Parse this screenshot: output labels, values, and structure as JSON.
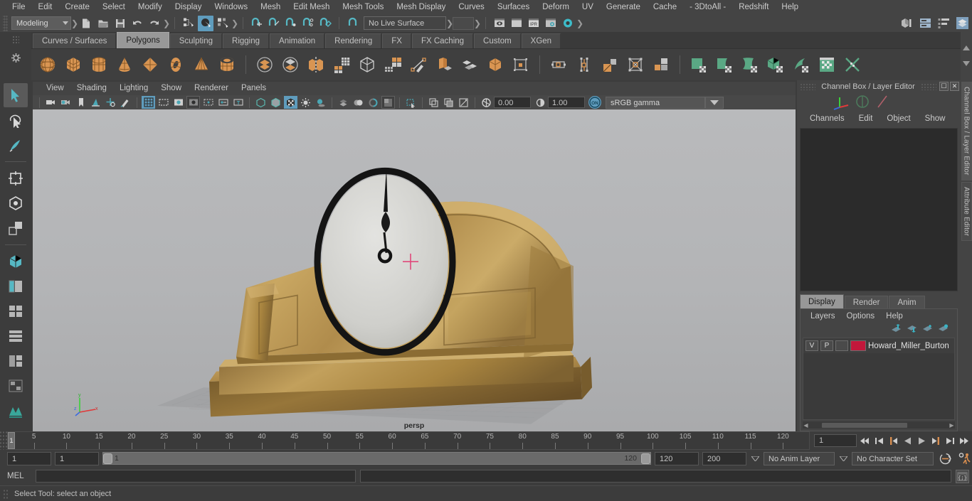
{
  "app": {
    "menus": [
      "File",
      "Edit",
      "Create",
      "Select",
      "Modify",
      "Display",
      "Windows",
      "Mesh",
      "Edit Mesh",
      "Mesh Tools",
      "Mesh Display",
      "Curves",
      "Surfaces",
      "Deform",
      "UV",
      "Generate",
      "Cache",
      "- 3DtoAll -",
      "Redshift",
      "Help"
    ]
  },
  "status_line": {
    "menu_set": "Modeling",
    "live_surface": "No Live Surface",
    "icons": [
      "new-scene-icon",
      "open-scene-icon",
      "save-scene-icon",
      "undo-icon",
      "redo-icon",
      "select-hierarchy-icon",
      "select-object-icon",
      "select-component-icon",
      "snap-to-grid-icon",
      "snap-to-curve-icon",
      "snap-to-point-icon",
      "snap-to-projected-center-icon",
      "snap-to-view-plane-icon",
      "make-live-icon",
      "render-view-icon",
      "render-current-frame-icon",
      "ipr-render-icon",
      "render-settings-icon",
      "hypershade-icon"
    ],
    "right_icons": [
      "show-hide-modeling-toolkit-icon",
      "show-hide-attribute-editor-icon",
      "show-hide-tool-settings-icon",
      "show-hide-channel-box-icon"
    ]
  },
  "shelf": {
    "tabs": [
      "Curves / Surfaces",
      "Polygons",
      "Sculpting",
      "Rigging",
      "Animation",
      "Rendering",
      "FX",
      "FX Caching",
      "Custom",
      "XGen"
    ],
    "selected_tab": "Polygons",
    "icons": [
      "poly-sphere-icon",
      "poly-cube-icon",
      "poly-cylinder-icon",
      "poly-cone-icon",
      "poly-plane-icon",
      "poly-torus-icon",
      "poly-pyramid-icon",
      "poly-pipe-icon",
      "combine-icon",
      "separate-icon",
      "mirror-icon",
      "smooth-icon",
      "boolean-icon",
      "extrude-icon",
      "bevel-icon",
      "multi-cut-icon",
      "bridge-icon",
      "merge-icon",
      "append-icon",
      "target-weld-icon",
      "offset-edge-loop-icon",
      "connect-icon",
      "detach-icon",
      "poly-crease-icon",
      "uv-editor-icon",
      "uv-planar-icon",
      "uv-cylindrical-icon",
      "uv-automatic-icon",
      "uv-unfold-icon",
      "uv-layout-icon",
      "uv-cut-sew-icon"
    ]
  },
  "toolbox": {
    "tools": [
      "select-tool",
      "lasso-select-tool",
      "paint-select-tool",
      "move-tool",
      "rotate-tool",
      "scale-tool",
      "last-tool-used",
      "show-manipulator-tool",
      "outliner-persp-layout-icon",
      "persp-layout-icon",
      "four-view-layout-icon",
      "two-pane-layout-icon",
      "single-pane-layout-icon",
      "hypershade-layout-icon",
      "maya-logo-icon"
    ]
  },
  "viewport": {
    "menus": [
      "View",
      "Shading",
      "Lighting",
      "Show",
      "Renderer",
      "Panels"
    ],
    "camera_label": "persp",
    "toolbar_icons": [
      "select-camera-icon",
      "camera-attributes-icon",
      "bookmark-icon",
      "image-plane-icon",
      "two-d-pan-zoom-icon",
      "grease-pencil-icon",
      "grid-toggle-icon",
      "film-gate-icon",
      "resolution-gate-icon",
      "gate-mask-icon",
      "film-origin-icon",
      "xray-joints-icon",
      "texture-border-icon",
      "wireframe-icon",
      "smooth-shade-icon",
      "shaded-wireframe-icon",
      "textured-icon",
      "use-default-lights-icon",
      "shadows-icon",
      "screen-space-ao-icon",
      "motion-blur-icon",
      "multisample-icon",
      "depth-peeling-icon",
      "isolate-select-icon",
      "xray-icon",
      "xray-active-components-icon",
      "xray-joints-2-icon",
      "exposure-icon",
      "gamma-icon"
    ],
    "exposure_value": "0.00",
    "gamma_value": "1.00",
    "color_space": "sRGB gamma",
    "view_transform_enabled": "ON"
  },
  "channel_box": {
    "panel_title": "Channel Box / Layer Editor",
    "menus": [
      "Channels",
      "Edit",
      "Object",
      "Show"
    ],
    "side_tabs": [
      "Channel Box / Layer Editor",
      "Attribute Editor"
    ],
    "window_buttons": [
      "undock-icon",
      "close-icon"
    ]
  },
  "layer_editor": {
    "tabs": [
      "Display",
      "Render",
      "Anim"
    ],
    "selected_tab": "Display",
    "menus": [
      "Layers",
      "Options",
      "Help"
    ],
    "buttons": [
      "move-layer-up-icon",
      "move-layer-down-icon",
      "create-new-layer-icon",
      "create-layer-from-selected-icon"
    ],
    "layers": [
      {
        "visibility": "V",
        "playback": "P",
        "shading": "",
        "color": "#c2173b",
        "name": "Howard_Miller_Burton"
      }
    ]
  },
  "timeline": {
    "current_frame_marker": "1",
    "ticks": [
      1,
      5,
      10,
      15,
      20,
      25,
      30,
      35,
      40,
      45,
      50,
      55,
      60,
      65,
      70,
      75,
      80,
      85,
      90,
      95,
      100,
      105,
      110,
      115,
      120
    ],
    "current_frame_field": "1",
    "playback_buttons": [
      "go-to-start-icon",
      "step-back-frame-icon",
      "step-back-key-icon",
      "play-backwards-icon",
      "play-forwards-icon",
      "step-forward-key-icon",
      "step-forward-frame-icon",
      "go-to-end-icon"
    ]
  },
  "range_slider": {
    "anim_start": "1",
    "playback_start": "1",
    "range_start_label": "1",
    "range_end_label": "120",
    "playback_end": "120",
    "anim_end": "200",
    "anim_layer": "No Anim Layer",
    "character_set": "No Character Set",
    "right_icons": [
      "auto-keyframe-icon",
      "animation-preferences-icon"
    ]
  },
  "command_line": {
    "label": "MEL",
    "input_value": "",
    "script_editor_button": "script-editor-icon"
  },
  "help_line": {
    "text": "Select Tool: select an object"
  },
  "colors": {
    "accent_blue": "#5f9cbd",
    "orange": "#d98e4f",
    "green": "#5aa884",
    "layer_red": "#c2173b",
    "chrome": "#444444",
    "viewport_bg": "#b6b7b9"
  }
}
